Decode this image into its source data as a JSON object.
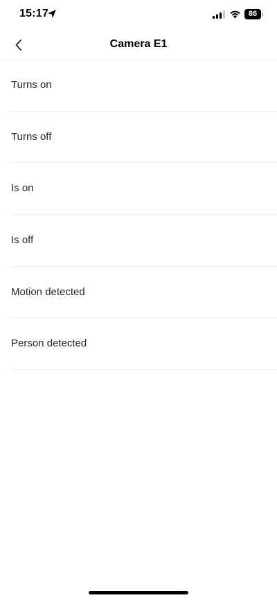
{
  "status_bar": {
    "time": "15:17",
    "battery_level": "86"
  },
  "nav": {
    "title": "Camera E1"
  },
  "triggers": [
    {
      "label": "Turns on"
    },
    {
      "label": "Turns off"
    },
    {
      "label": "Is on"
    },
    {
      "label": "Is off"
    },
    {
      "label": "Motion detected"
    },
    {
      "label": "Person detected"
    }
  ]
}
